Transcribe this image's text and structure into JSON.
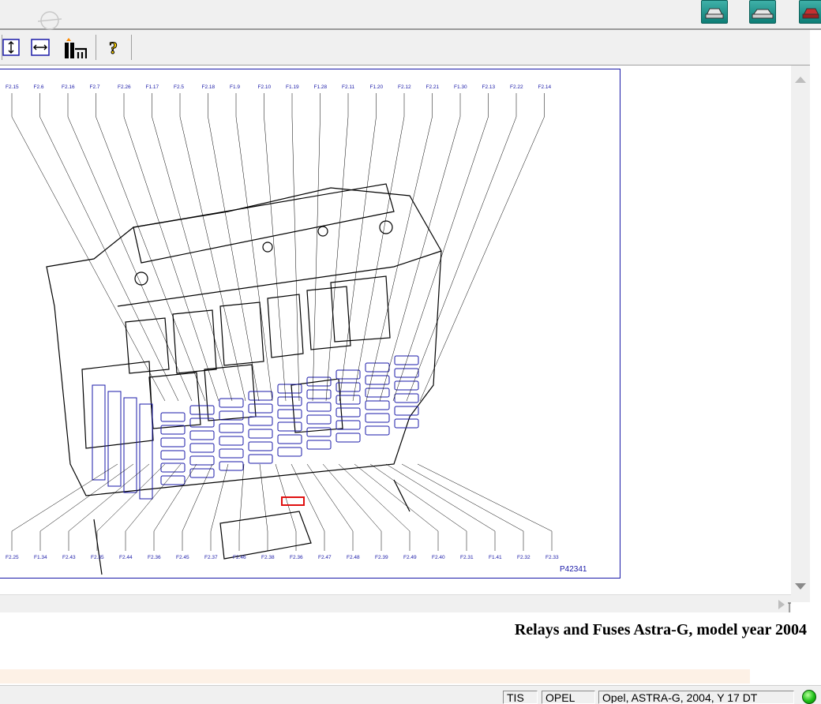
{
  "toolbar": {
    "buttons": [
      {
        "name": "fit-height-button",
        "icon": "fit-height-icon"
      },
      {
        "name": "fit-width-button",
        "icon": "fit-width-icon"
      },
      {
        "name": "component-locator-button",
        "icon": "component-locator-icon"
      },
      {
        "name": "help-button",
        "icon": "help-icon",
        "glyph": "?"
      }
    ]
  },
  "top_right_buttons": [
    "car-front-icon",
    "car-side-icon",
    "car-rear-icon"
  ],
  "diagram": {
    "labels_top": [
      "F2.15",
      "F2.6",
      "F2.16",
      "F2.7",
      "F2.26",
      "F1.17",
      "F2.5",
      "F2.18",
      "F1.9",
      "F2.10",
      "F1.19",
      "F1.28",
      "F2.11",
      "F1.20",
      "F2.12",
      "F2.21",
      "F1.30",
      "F2.13",
      "F2.22",
      "F2.14"
    ],
    "labels_bottom": [
      "F2.25",
      "F1.34",
      "F2.43",
      "F2.35",
      "F2.44",
      "F2.36",
      "F2.45",
      "F2.37",
      "F2.46",
      "F2.38",
      "F2.36",
      "F2.47",
      "F2.48",
      "F2.39",
      "F2.49",
      "F2.40",
      "F2.31",
      "F1.41",
      "F2.32",
      "F2.33"
    ],
    "ref_code": "P42341",
    "highlight_color": "#e01010",
    "fuse_color": "#1a1aa8"
  },
  "caption": "Relays and Fuses Astra-G, model year 2004",
  "status": {
    "fields": [
      "TIS",
      "OPEL",
      "Opel, ASTRA-G, 2004, Y 17 DT"
    ],
    "indicator_color": "#1bbf16"
  }
}
